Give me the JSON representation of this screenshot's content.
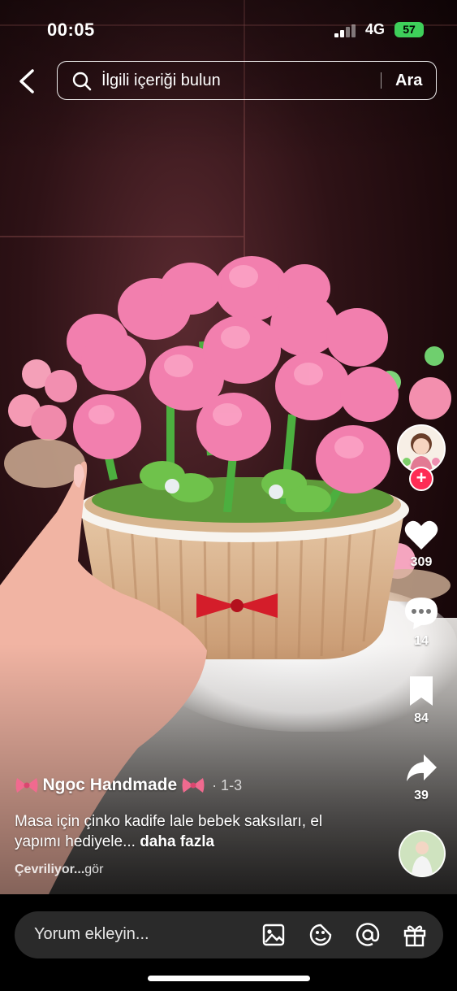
{
  "status_bar": {
    "time": "00:05",
    "network": "4G",
    "battery": "57"
  },
  "search": {
    "placeholder": "İlgili içeriği bulun",
    "button": "Ara"
  },
  "actions": {
    "likes": "309",
    "comments": "14",
    "saves": "84",
    "shares": "39"
  },
  "post": {
    "author": "Ngọc Handmade",
    "meta": "· 1-3",
    "caption": "Masa için çinko kadife lale bebek saksıları, el yapımı hediyele...",
    "more": "daha fazla",
    "translation_status": "Çevriliyor...",
    "translation_tail": "gör"
  },
  "comment_bar": {
    "placeholder": "Yorum ekleyin..."
  },
  "colors": {
    "like": "#ffffff",
    "follow": "#fe2c55",
    "bar": "#2a2a2a"
  },
  "icons": [
    "back-icon",
    "search-icon",
    "heart-icon",
    "comment-icon",
    "bookmark-icon",
    "share-icon",
    "image-icon",
    "emoji-icon",
    "mention-icon",
    "gift-icon"
  ]
}
